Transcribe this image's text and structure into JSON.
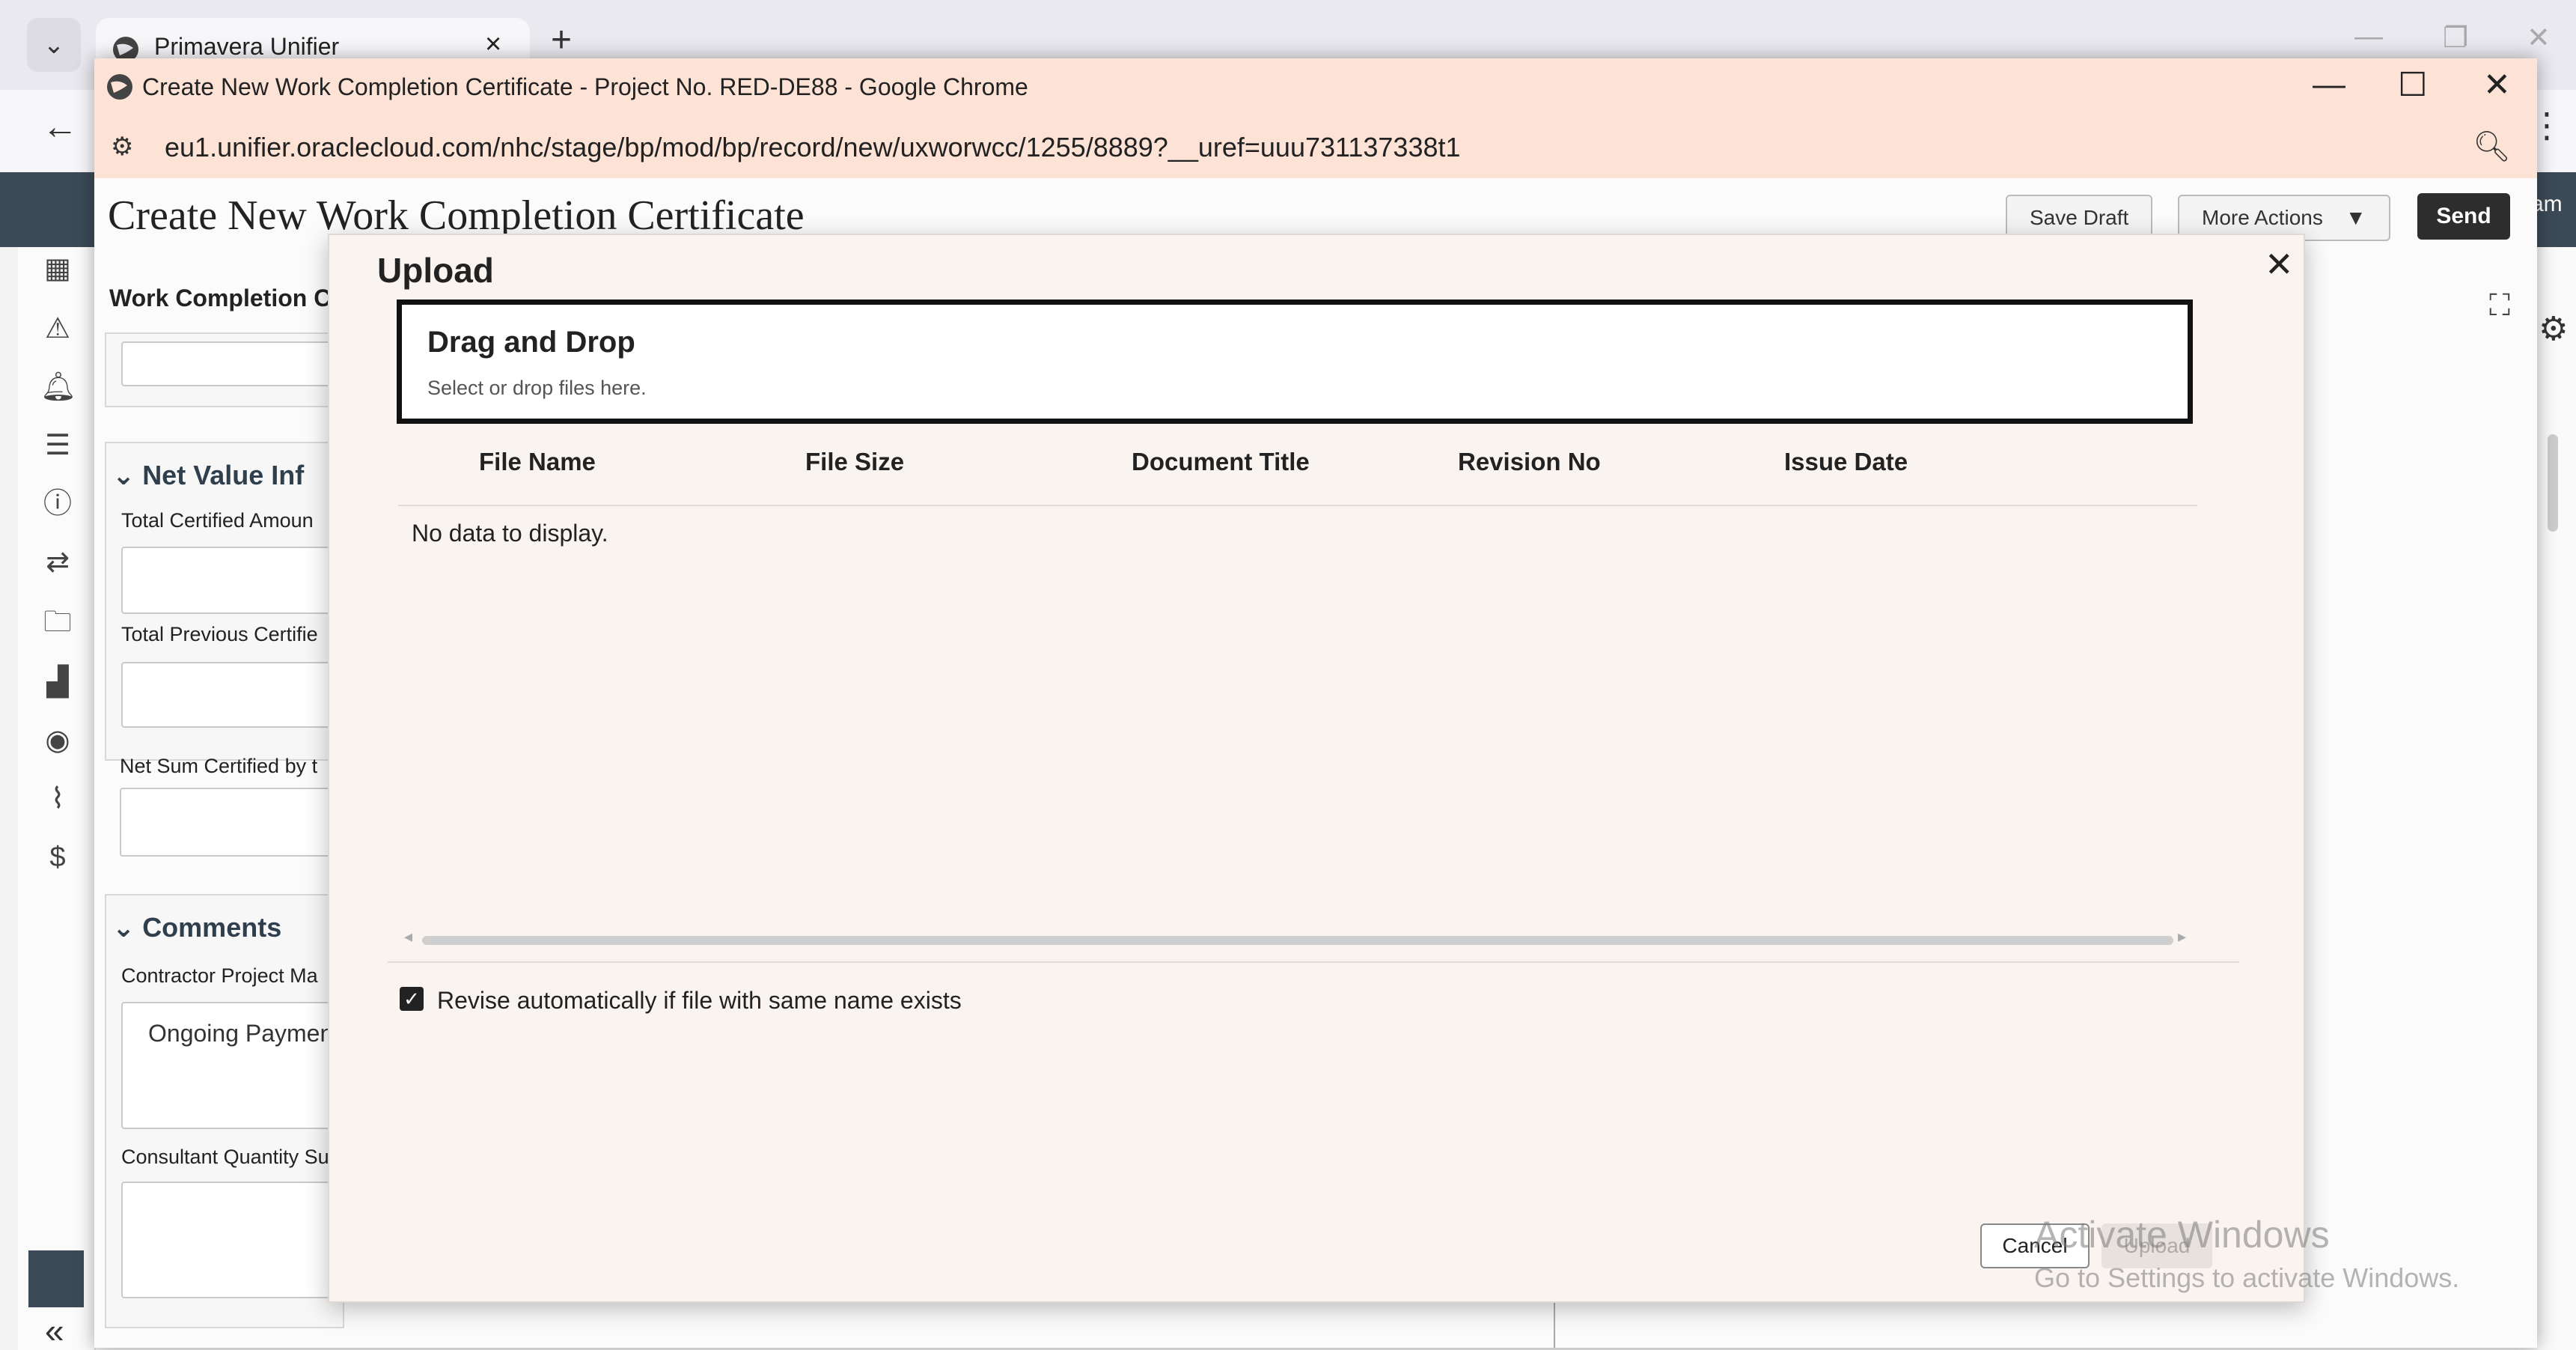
{
  "back_browser": {
    "tab_title": "Primavera Unifier",
    "tab_close": "×",
    "new_tab": "+",
    "user_fragment": "am"
  },
  "popup": {
    "window_title": "Create New Work Completion Certificate - Project No. RED-DE88 - Google Chrome",
    "url": "eu1.unifier.oraclecloud.com/nhc/stage/bp/mod/bp/record/new/uxworwcc/1255/8889?__uref=uuu731137338t1"
  },
  "page": {
    "title": "Create New Work Completion Certificate",
    "save_draft": "Save Draft",
    "more_actions": "More Actions",
    "send": "Send",
    "section_tab": "Work Completion Ce",
    "net_value_section": "Net Value Inf",
    "total_certified": "Total Certified Amoun",
    "total_previous": "Total Previous Certifie",
    "net_sum": "Net Sum Certified by t",
    "comments_section": "Comments",
    "contractor_pm": "Contractor Project Ma",
    "contractor_pm_value": "Ongoing Paymen",
    "consultant_qs": "Consultant Quantity Su"
  },
  "upload_dialog": {
    "title": "Upload",
    "dropzone_title": "Drag and Drop",
    "dropzone_subtitle": "Select or drop files here.",
    "columns": [
      "File Name",
      "File Size",
      "Document Title",
      "Revision No",
      "Issue Date"
    ],
    "empty_message": "No data to display.",
    "revise_label": "Revise automatically if file with same name exists",
    "revise_checked": true,
    "cancel": "Cancel",
    "upload": "Upload"
  },
  "watermark": {
    "line1": "Activate Windows",
    "line2": "Go to Settings to activate Windows."
  }
}
